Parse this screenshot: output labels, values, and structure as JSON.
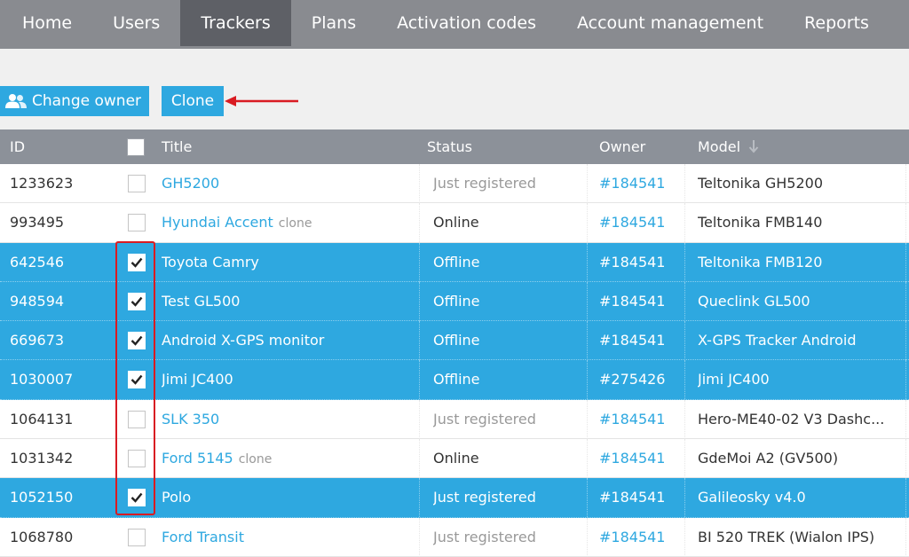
{
  "nav": {
    "items": [
      {
        "label": "Home",
        "active": false
      },
      {
        "label": "Users",
        "active": false
      },
      {
        "label": "Trackers",
        "active": true
      },
      {
        "label": "Plans",
        "active": false
      },
      {
        "label": "Activation codes",
        "active": false
      },
      {
        "label": "Account management",
        "active": false
      },
      {
        "label": "Reports",
        "active": false
      }
    ]
  },
  "toolbar": {
    "change_owner_label": "Change owner",
    "change_owner_icon": "users-icon",
    "clone_label": "Clone"
  },
  "table": {
    "headers": {
      "id": "ID",
      "title": "Title",
      "status": "Status",
      "owner": "Owner",
      "model": "Model"
    },
    "sort_icon": "arrow-down-icon",
    "rows": [
      {
        "id": "1233623",
        "title": "GH5200",
        "tag": "",
        "status": "Just registered",
        "owner": "#184541",
        "model": "Teltonika GH5200",
        "selected": false
      },
      {
        "id": "993495",
        "title": "Hyundai Accent",
        "tag": "clone",
        "status": "Online",
        "owner": "#184541",
        "model": "Teltonika FMB140",
        "selected": false
      },
      {
        "id": "642546",
        "title": "Toyota Camry",
        "tag": "",
        "status": "Offline",
        "owner": "#184541",
        "model": "Teltonika FMB120",
        "selected": true
      },
      {
        "id": "948594",
        "title": "Test GL500",
        "tag": "",
        "status": "Offline",
        "owner": "#184541",
        "model": "Queclink GL500",
        "selected": true
      },
      {
        "id": "669673",
        "title": "Android X-GPS monitor",
        "tag": "",
        "status": "Offline",
        "owner": "#184541",
        "model": "X-GPS Tracker Android",
        "selected": true
      },
      {
        "id": "1030007",
        "title": "Jimi JC400",
        "tag": "",
        "status": "Offline",
        "owner": "#275426",
        "model": "Jimi JC400",
        "selected": true
      },
      {
        "id": "1064131",
        "title": "SLK 350",
        "tag": "",
        "status": "Just registered",
        "owner": "#184541",
        "model": "Hero-ME40-02 V3 Dashc...",
        "selected": false
      },
      {
        "id": "1031342",
        "title": "Ford 5145",
        "tag": "clone",
        "status": "Online",
        "owner": "#184541",
        "model": "GdeMoi A2 (GV500)",
        "selected": false
      },
      {
        "id": "1052150",
        "title": "Polo",
        "tag": "",
        "status": "Just registered",
        "owner": "#184541",
        "model": "Galileosky v4.0",
        "selected": true
      },
      {
        "id": "1068780",
        "title": "Ford Transit",
        "tag": "",
        "status": "Just registered",
        "owner": "#184541",
        "model": "BI 520 TREK (Wialon IPS)",
        "selected": false
      }
    ]
  },
  "colors": {
    "accent": "#2ea8e0",
    "nav_bg": "#898b90",
    "nav_active": "#5e6066",
    "header_bg": "#8c9199",
    "annotation": "#d91b22"
  }
}
